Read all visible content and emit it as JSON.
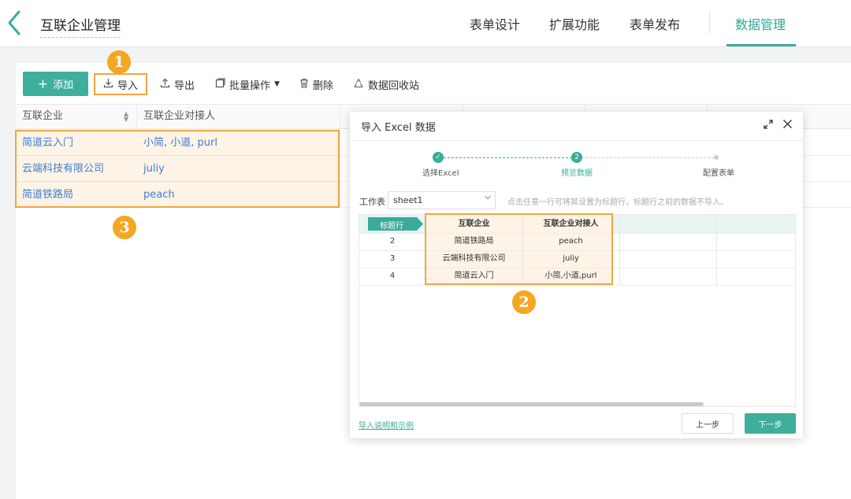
{
  "header": {
    "title": "互联企业管理",
    "tabs": [
      {
        "label": "表单设计"
      },
      {
        "label": "扩展功能"
      },
      {
        "label": "表单发布"
      },
      {
        "label": "数据管理"
      }
    ],
    "accent_color": "#3aab9a"
  },
  "toolbar": {
    "add_label": "添加",
    "import_label": "导入",
    "export_label": "导出",
    "batch_label": "批量操作",
    "delete_label": "删除",
    "recycle_label": "数据回收站"
  },
  "badges": {
    "one": "1",
    "two": "2",
    "three": "3"
  },
  "grid": {
    "columns": [
      "互联企业",
      "互联企业对接人"
    ],
    "rows": [
      {
        "company": "简道云入门",
        "contact": "小简, 小道, purl"
      },
      {
        "company": "云端科技有限公司",
        "contact": "juliy"
      },
      {
        "company": "简道铁路局",
        "contact": "peach"
      }
    ]
  },
  "dialog": {
    "title": "导入 Excel 数据",
    "steps": [
      {
        "label": "选择Excel",
        "number": "✓"
      },
      {
        "label": "预览数据",
        "number": "2"
      },
      {
        "label": "配置表单"
      }
    ],
    "worksheet_label": "工作表",
    "worksheet_value": "sheet1",
    "hint": "点击任意一行可将其设置为标题行，标题行之前的数据不导入。",
    "header_tag": "标题行",
    "preview_columns": [
      "互联企业",
      "互联企业对接人"
    ],
    "preview_rows": [
      {
        "index": "2",
        "company": "简道铁路局",
        "contact": "peach"
      },
      {
        "index": "3",
        "company": "云端科技有限公司",
        "contact": "juliy"
      },
      {
        "index": "4",
        "company": "简道云入门",
        "contact": "小简,小道,purl"
      }
    ],
    "help_link": "导入说明和示例",
    "prev_label": "上一步",
    "next_label": "下一步"
  }
}
